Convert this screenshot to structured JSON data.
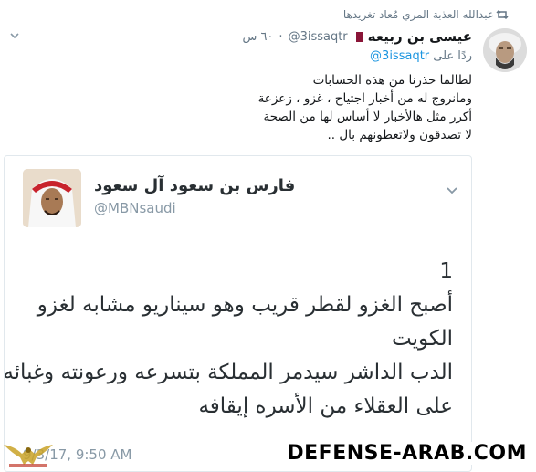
{
  "retweet": {
    "label": "عبدالله العذبة المري مُعاد تغريدها"
  },
  "tweet": {
    "name": "عيسى بن ربيعه",
    "handle": "@3issaqtr",
    "time": "٦٠ س",
    "reply_prefix": "ردًا على",
    "reply_mention": "@3issaqtr",
    "lines": [
      "لطالما حذرنا من هذه الحسابات",
      "ومانروج له من أخبار اجتياح ، غزو ، زعزعة",
      "أكرر مثل هالأخبار لا أساس لها من الصحة",
      "لا تصدقون ولاتعطونهم بال .."
    ]
  },
  "quoted": {
    "name": "فارس بن سعود آل سعود",
    "handle": "@MBNsaudi",
    "lines": [
      "1",
      "أصبح الغزو لقطر قريب وهو  سيناريو مشابه لغزو",
      "الكويت",
      "الدب الداشر سيدمر المملكة بتسرعه ورعونته وغبائه",
      "على العقلاء من الأسره إيقافه"
    ],
    "timestamp": "9/3/17, 9:50 AM"
  },
  "watermark": {
    "text": "DEFENSE-ARAB.COM"
  },
  "icons": {
    "retweet": "retweet-icon",
    "chevron": "chevron-down-icon"
  },
  "colors": {
    "link": "#1b95e0",
    "muted": "#657786",
    "border": "#e1e8ed"
  }
}
